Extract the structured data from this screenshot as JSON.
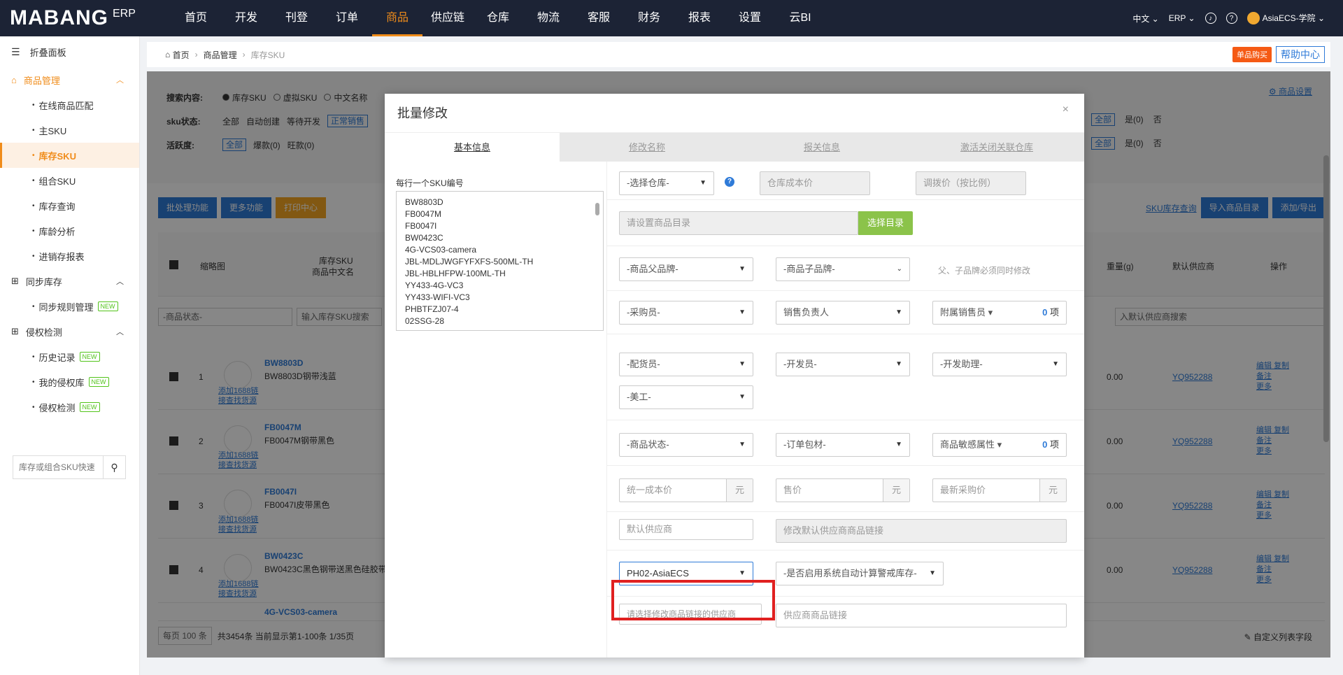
{
  "header": {
    "brand_main": "MABANG",
    "brand_erp": "ERP",
    "nav": [
      "首页",
      "开发",
      "刊登",
      "订单",
      "商品",
      "供应链",
      "仓库",
      "物流",
      "客服",
      "财务",
      "报表",
      "设置",
      "云BI"
    ],
    "active_nav": "商品",
    "lang": "中文",
    "erp_menu": "ERP",
    "user": "AsiaECS-学院"
  },
  "sidebar": {
    "collapse": "折叠面板",
    "groups": [
      {
        "label": "商品管理",
        "items": [
          "在线商品匹配",
          "主SKU",
          "库存SKU",
          "组合SKU",
          "库存查询",
          "库龄分析",
          "进销存报表"
        ]
      },
      {
        "label": "同步库存",
        "items": [
          "同步规则管理"
        ]
      },
      {
        "label": "侵权检测",
        "items": [
          "历史记录",
          "我的侵权库",
          "侵权检测"
        ]
      }
    ],
    "active_item": "库存SKU",
    "new_tag": "NEW",
    "search_placeholder": "库存或组合SKU快速"
  },
  "breadcrumb": {
    "home": "首页",
    "section": "商品管理",
    "current": "库存SKU"
  },
  "top_buttons": {
    "buy": "单品购买",
    "help": "帮助中心"
  },
  "background_page": {
    "search_label": "搜索内容:",
    "search_options": [
      "库存SKU",
      "虚拟SKU",
      "中文名称"
    ],
    "sku_status_label": "sku状态:",
    "sku_status": [
      "全部",
      "自动创建",
      "等待开发",
      "正常销售"
    ],
    "activity_label": "活跃度:",
    "activity": [
      "全部",
      "爆款(0)",
      "旺款(0)"
    ],
    "settings_link": "商品设置",
    "right_filters": {
      "all": "全部",
      "yes": "是(0)",
      "no": "否"
    },
    "batch_btn": "批处理功能",
    "more_btn": "更多功能",
    "print_btn": "打印中心",
    "sku_inventory_link": "SKU库存查询",
    "import_btn": "导入商品目录",
    "add_export_btn": "添加/导出",
    "col_thumb": "缩略图",
    "col_sku": "库存SKU",
    "col_cn": "商品中文名",
    "col_weight": "重量(g)",
    "col_supplier": "默认供应商",
    "col_ops": "操作",
    "status_filter": "-商品状态-",
    "sku_search": "输入库存SKU搜索",
    "supplier_search": "入默认供应商搜索",
    "link_1688": "添加1688链接查找货源",
    "op_edit": "编辑",
    "op_copy": "复制",
    "op_note": "备注",
    "op_more": "更多",
    "rows": [
      {
        "num": "1",
        "sku": "BW8803D",
        "cn": "BW8803D钢带浅蓝",
        "weight": "0.00",
        "supplier": "YQ952288"
      },
      {
        "num": "2",
        "sku": "FB0047M",
        "cn": "FB0047M钢带黑色",
        "weight": "0.00",
        "supplier": "YQ952288"
      },
      {
        "num": "3",
        "sku": "FB0047I",
        "cn": "FB0047I皮带黑色",
        "weight": "0.00",
        "supplier": "YQ952288"
      },
      {
        "num": "4",
        "sku": "BW0423C",
        "cn": "BW0423C黑色钢带送黑色硅胶带",
        "weight": "0.00",
        "supplier": "YQ952288"
      },
      {
        "num": "5",
        "sku": "4G-VCS03-camera",
        "cn": "",
        "weight": "",
        "supplier": ""
      }
    ],
    "pager_per_page": "每页 100 条",
    "pager_total": "共3454条 当前显示第1-100条 1/35页",
    "custom_cols": "自定义列表字段"
  },
  "modal": {
    "title": "批量修改",
    "tabs": [
      "基本信息",
      "修改名称",
      "报关信息",
      "激活关闭关联仓库"
    ],
    "active_tab": "基本信息",
    "sku_list_label": "每行一个SKU编号",
    "sku_list": [
      "BW8803D",
      "FB0047M",
      "FB0047I",
      "BW0423C",
      "4G-VCS03-camera",
      "JBL-MDLJWGFYFXFS-500ML-TH",
      "JBL-HBLHFPW-100ML-TH",
      "YY433-4G-VC3",
      "YY433-WIFI-VC3",
      "PHBTFZJ07-4",
      "02SSG-28"
    ],
    "warehouse_select": "-选择仓库-",
    "warehouse_cost": "仓库成本价",
    "transfer_price": "调拨价（按比例）",
    "catalog_placeholder": "请设置商品目录",
    "catalog_btn": "选择目录",
    "parent_brand": "-商品父品牌-",
    "child_brand": "-商品子品牌-",
    "brand_note": "父、子品牌必须同时修改",
    "buyer": "-采购员-",
    "sales_owner": "销售负责人",
    "sub_sales": "附属销售员",
    "count_zero": "0",
    "count_unit": "项",
    "allocator": "-配货员-",
    "developer": "-开发员-",
    "dev_assist": "-开发助理-",
    "artist": "-美工-",
    "product_status": "-商品状态-",
    "package_material": "-订单包材-",
    "sensitive": "商品敏感属性",
    "unified_cost": "统一成本价",
    "sale_price": "售价",
    "latest_purchase": "最新采购价",
    "currency": "元",
    "default_supplier": "默认供应商",
    "supplier_link_placeholder": "修改默认供应商商品链接",
    "selected_supplier": "PH02-AsiaECS",
    "auto_warn": "-是否启用系统自动计算警戒库存-",
    "select_supplier_placeholder": "请选择修改商品链接的供应商",
    "supplier_product_link": "供应商商品链接"
  }
}
